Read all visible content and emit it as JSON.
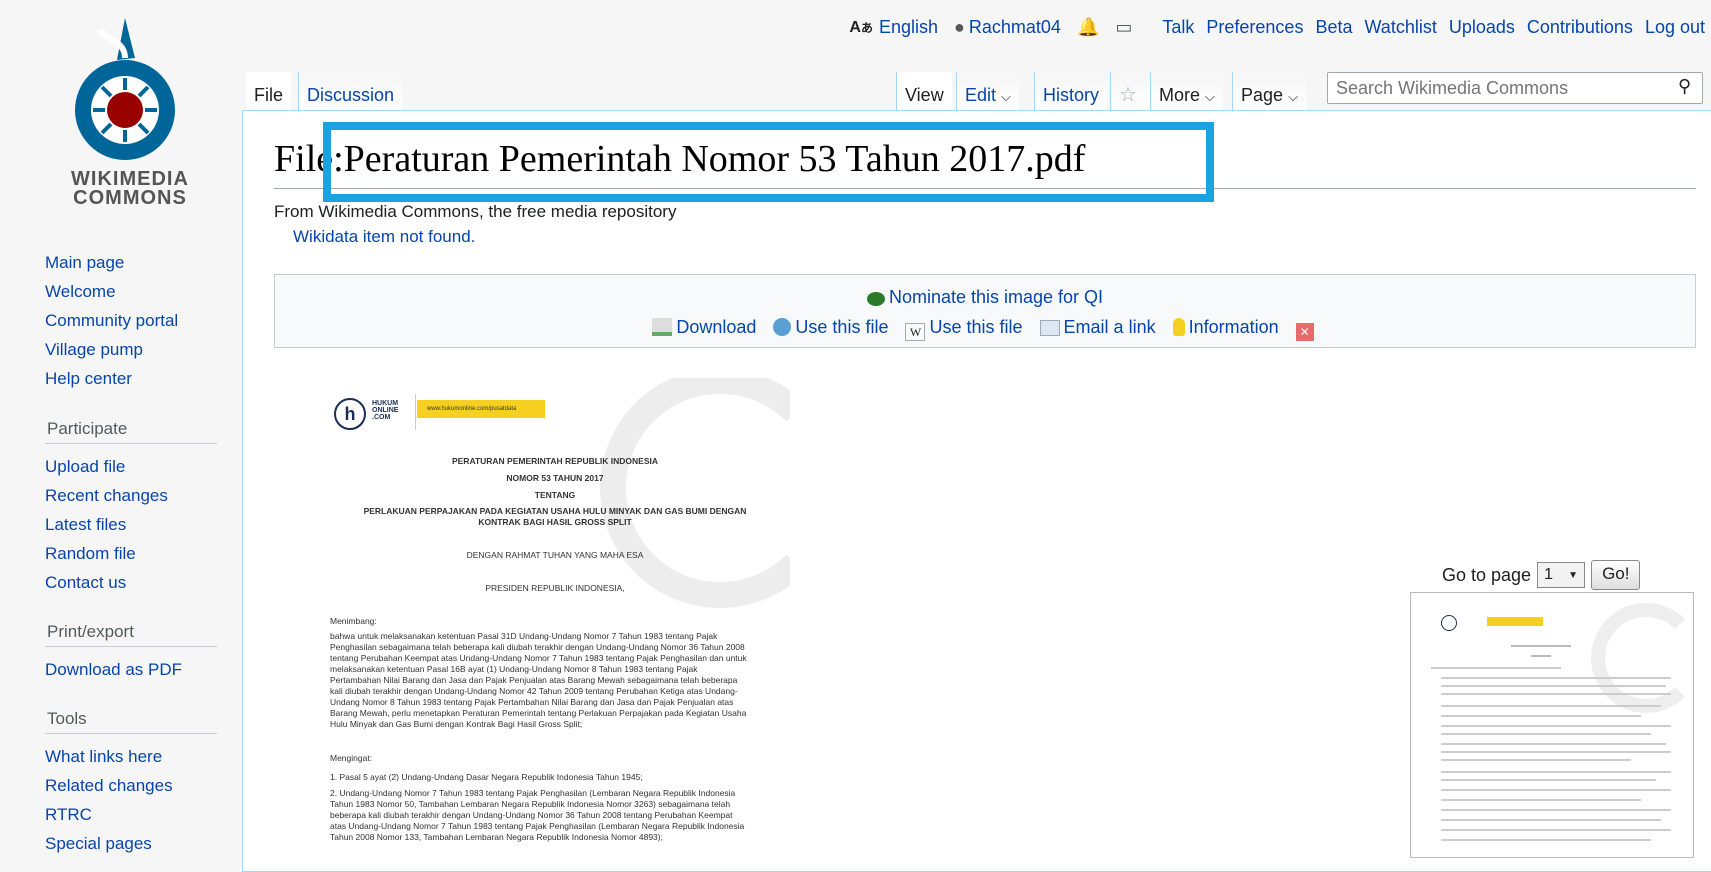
{
  "logo": {
    "line1": "WIKIMEDIA",
    "line2": "COMMONS"
  },
  "personal": {
    "language": "English",
    "user": "Rachmat04",
    "links": [
      "Talk",
      "Preferences",
      "Beta",
      "Watchlist",
      "Uploads",
      "Contributions",
      "Log out"
    ]
  },
  "tabs": {
    "file": "File",
    "discussion": "Discussion",
    "view": "View",
    "edit": "Edit",
    "history": "History",
    "more": "More",
    "page": "Page"
  },
  "search": {
    "placeholder": "Search Wikimedia Commons"
  },
  "sidebar": {
    "main": [
      "Main page",
      "Welcome",
      "Community portal",
      "Village pump",
      "Help center"
    ],
    "participate_heading": "Participate",
    "participate": [
      "Upload file",
      "Recent changes",
      "Latest files",
      "Random file",
      "Contact us"
    ],
    "print_heading": "Print/export",
    "print": [
      "Download as PDF"
    ],
    "tools_heading": "Tools",
    "tools": [
      "What links here",
      "Related changes",
      "RTRC",
      "Special pages"
    ]
  },
  "page": {
    "title": "File:Peraturan Pemerintah Nomor 53 Tahun 2017.pdf",
    "tagline": "From Wikimedia Commons, the free media repository",
    "wikidata": "Wikidata item not found."
  },
  "actionbox": {
    "nominate": "Nominate this image for QI",
    "download": "Download",
    "use_file_1": "Use this file",
    "use_file_2": "Use this file",
    "email": "Email a link",
    "information": "Information"
  },
  "pdf": {
    "brand": "HUKUM ONLINE .COM",
    "url": "www.hukumonline.com/pusatdata",
    "heading1": "PERATURAN PEMERINTAH REPUBLIK INDONESIA",
    "heading2": "NOMOR 53 TAHUN 2017",
    "heading3": "TENTANG",
    "heading4": "PERLAKUAN PERPAJAKAN PADA KEGIATAN USAHA HULU MINYAK DAN GAS BUMI DENGAN",
    "heading5": "KONTRAK BAGI HASIL GROSS SPLIT",
    "rahmat": "DENGAN RAHMAT TUHAN YANG MAHA ESA",
    "presiden": "PRESIDEN REPUBLIK INDONESIA,",
    "menimbang_label": "Menimbang:",
    "menimbang_text": "bahwa untuk melaksanakan ketentuan Pasal 31D Undang-Undang Nomor 7 Tahun 1983 tentang Pajak Penghasilan sebagaimana telah beberapa kali diubah terakhir dengan Undang-Undang Nomor 36 Tahun 2008 tentang Perubahan Keempat atas Undang-Undang Nomor 7 Tahun 1983 tentang Pajak Penghasilan dan untuk melaksanakan ketentuan Pasal 16B ayat (1) Undang-Undang Nomor 8 Tahun 1983 tentang Pajak Pertambahan Nilai Barang dan Jasa dan Pajak Penjualan atas Barang Mewah sebagaimana telah beberapa kali diubah terakhir dengan Undang-Undang Nomor 42 Tahun 2009 tentang Perubahan Ketiga atas Undang-Undang Nomor 8 Tahun 1983 tentang Pajak Pertambahan Nilai Barang dan Jasa dan Pajak Penjualan atas Barang Mewah, perlu menetapkan Peraturan Pemerintah tentang Perlakuan Perpajakan pada Kegiatan Usaha Hulu Minyak dan Gas Bumi dengan Kontrak Bagi Hasil Gross Split;",
    "mengingat_label": "Mengingat:",
    "mengingat_1": "1.   Pasal 5 ayat (2) Undang-Undang Dasar Negara Republik Indonesia Tahun 1945;",
    "mengingat_2": "2.   Undang-Undang Nomor 7 Tahun 1983 tentang Pajak Penghasilan (Lembaran Negara Republik Indonesia Tahun 1983 Nomor 50, Tambahan Lembaran Negara Republik Indonesia Nomor 3263) sebagaimana telah beberapa kali diubah terakhir dengan Undang-Undang Nomor 36 Tahun 2008 tentang Perubahan Keempat atas Undang-Undang Nomor 7 Tahun 1983 tentang Pajak Penghasilan (Lembaran Negara Republik Indonesia Tahun 2008 Nomor 133, Tambahan Lembaran Negara Republik Indonesia Nomor 4893);"
  },
  "navigator": {
    "goto_label": "Go to page",
    "page_value": "1",
    "go_button": "Go!"
  }
}
